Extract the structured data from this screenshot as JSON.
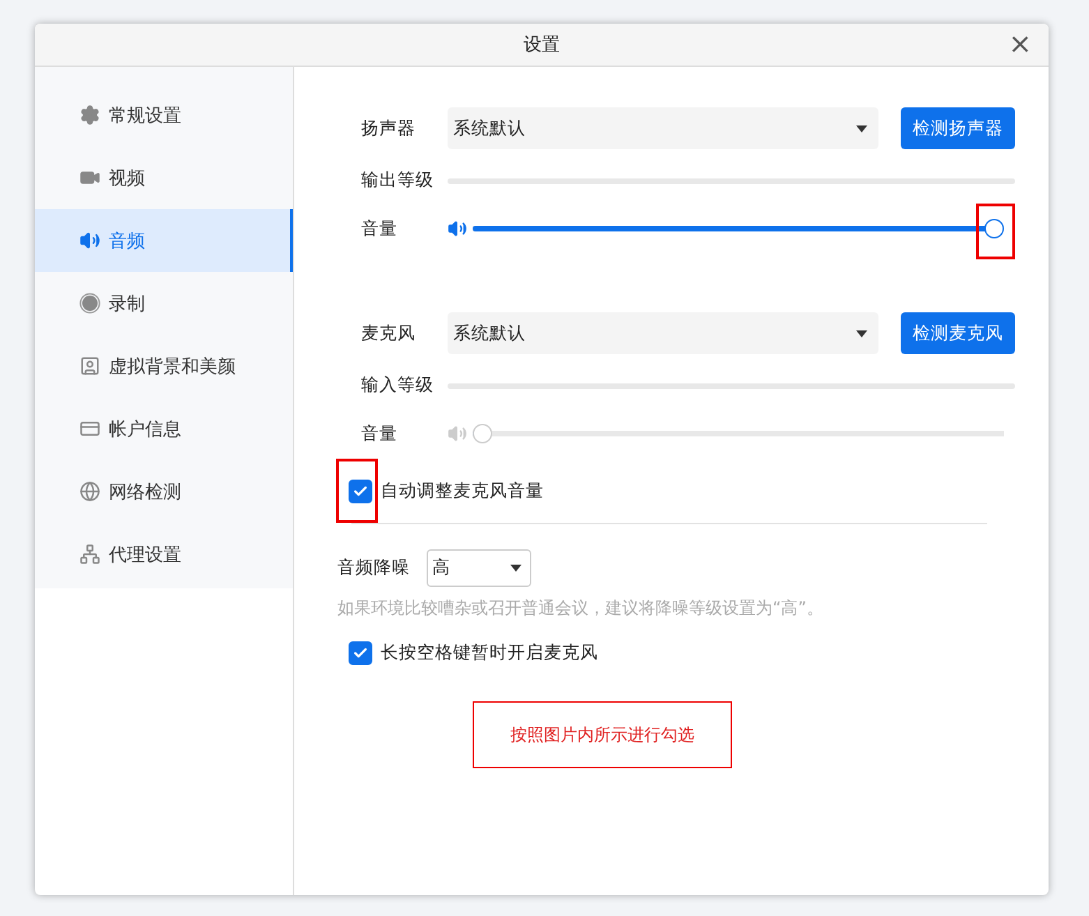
{
  "window": {
    "title": "设置",
    "close": "×"
  },
  "sidebar": {
    "items": [
      {
        "label": "常规设置",
        "selected": false
      },
      {
        "label": "视频",
        "selected": false
      },
      {
        "label": "音频",
        "selected": true
      },
      {
        "label": "录制",
        "selected": false
      },
      {
        "label": "虚拟背景和美颜",
        "selected": false
      },
      {
        "label": "帐户信息",
        "selected": false
      },
      {
        "label": "网络检测",
        "selected": false
      },
      {
        "label": "代理设置",
        "selected": false
      }
    ]
  },
  "speaker": {
    "label": "扬声器",
    "device": "系统默认",
    "test_button": "检测扬声器",
    "level_label": "输出等级",
    "volume_label": "音量",
    "volume": {
      "level": 1,
      "enabled": true,
      "highlighted": true
    }
  },
  "microphone": {
    "label": "麦克风",
    "device": "系统默认",
    "test_button": "检测麦克风",
    "level_label": "输入等级",
    "volume_label": "音量",
    "volume": {
      "level": 0,
      "enabled": false
    }
  },
  "auto_adjust": {
    "label": "自动调整麦克风音量",
    "checked": true,
    "highlighted": true
  },
  "noise": {
    "label": "音频降噪",
    "value": "高",
    "hint": "如果环境比较嘈杂或召开普通会议，建议将降噪等级设置为“高”。"
  },
  "push_to_talk": {
    "label": "长按空格键暂时开启麦克风",
    "checked": true
  },
  "annotation": {
    "text": "按照图片内所示进行勾选"
  }
}
